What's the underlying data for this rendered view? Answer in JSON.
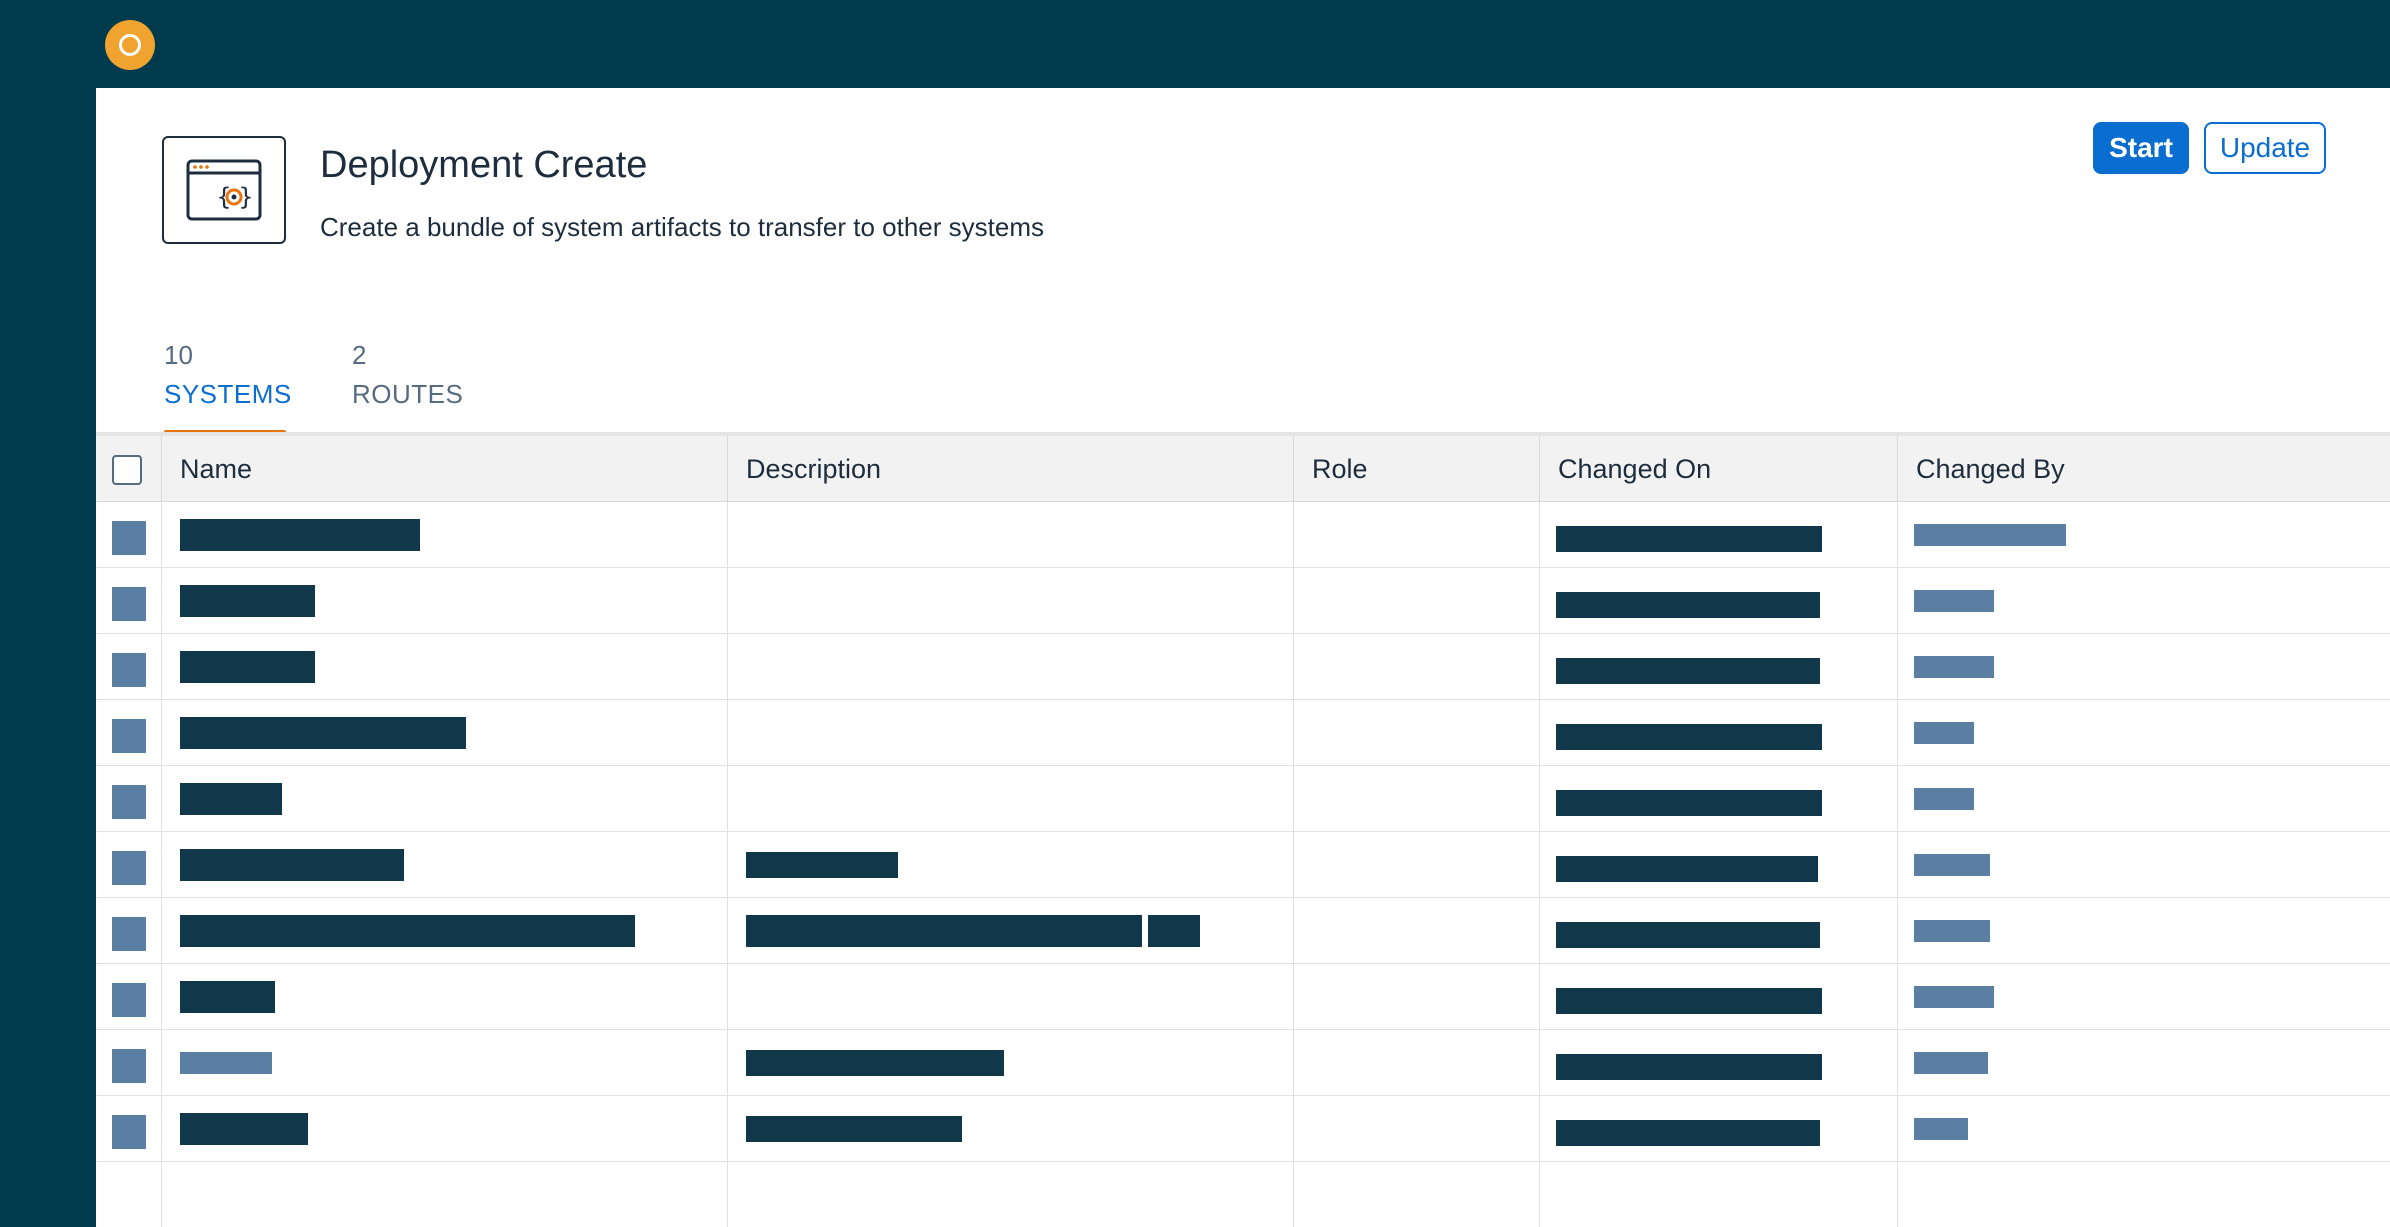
{
  "header": {
    "title": "Deployment Create",
    "subtitle": "Create a bundle of system artifacts to transfer to other systems",
    "icon": "code-window-gear-icon",
    "actions": {
      "start_label": "Start",
      "update_label": "Update"
    }
  },
  "tabs": [
    {
      "count": "10",
      "label": "SYSTEMS",
      "selected": true
    },
    {
      "count": "2",
      "label": "ROUTES",
      "selected": false
    }
  ],
  "table": {
    "columns": [
      "Name",
      "Description",
      "Role",
      "Changed On",
      "Changed By"
    ],
    "row_count": 10,
    "note_redacted": "cell values are redacted in the screenshot"
  },
  "colors": {
    "shell": "#003b4d",
    "accent": "#0a6ed1",
    "tab_indicator": "#e9730c",
    "logo": "#f0a32f",
    "redaction_dark": "#11374b",
    "redaction_light": "#5b7fa3"
  }
}
